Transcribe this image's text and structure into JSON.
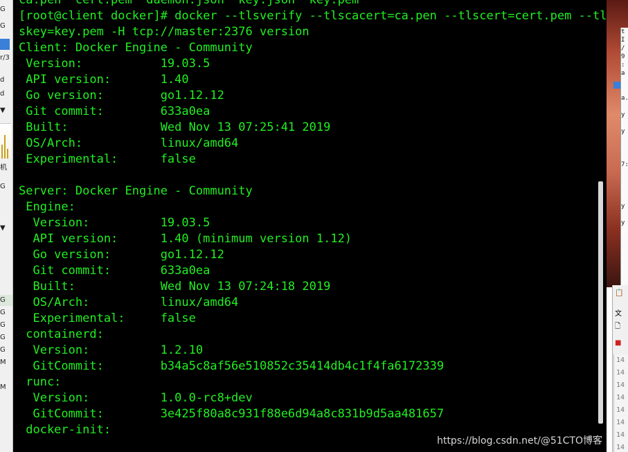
{
  "terminal": {
    "lines": [
      "ca.pen  cert.pem  daemon.json  key.json  key.pem",
      "[root@client docker]# docker --tlsverify --tlscacert=ca.pen --tlscert=cert.pem --tl",
      "skey=key.pem -H tcp://master:2376 version",
      "Client: Docker Engine - Community",
      " Version:           19.03.5",
      " API version:       1.40",
      " Go version:        go1.12.12",
      " Git commit:        633a0ea",
      " Built:             Wed Nov 13 07:25:41 2019",
      " OS/Arch:           linux/amd64",
      " Experimental:      false",
      "",
      "Server: Docker Engine - Community",
      " Engine:",
      "  Version:          19.03.5",
      "  API version:      1.40 (minimum version 1.12)",
      "  Go version:       go1.12.12",
      "  Git commit:       633a0ea",
      "  Built:            Wed Nov 13 07:24:18 2019",
      "  OS/Arch:          linux/amd64",
      "  Experimental:     false",
      " containerd:",
      "  Version:          1.2.10",
      "  GitCommit:        b34a5c8af56e510852c35414db4c1f4fa6172339",
      " runc:",
      "  Version:          1.0.0-rc8+dev",
      "  GitCommit:        3e425f80a8c931f88e6d94a8c831b9d5aa481657",
      " docker-init:"
    ],
    "text_color": "#22ee22",
    "background": "#000000"
  },
  "watermark": "https://blog.csdn.net/@51CTO博客",
  "left_strip": {
    "items": [
      "G",
      "G",
      "r/3",
      "d",
      "d",
      "机",
      "G",
      "G",
      "G",
      "G",
      "G",
      "G",
      "M",
      "M"
    ]
  },
  "right_strip": {
    "panel_chars": [
      "t",
      "I",
      "/",
      "9",
      ":",
      "a",
      "",
      "",
      "a.",
      "",
      "y",
      "",
      "y",
      "",
      "",
      "",
      "7:",
      "",
      "",
      "",
      "",
      "y",
      "",
      "y"
    ],
    "win2_labels": [
      "文",
      "14",
      "14",
      "14",
      "14",
      "14",
      "14",
      "14",
      "14"
    ]
  }
}
